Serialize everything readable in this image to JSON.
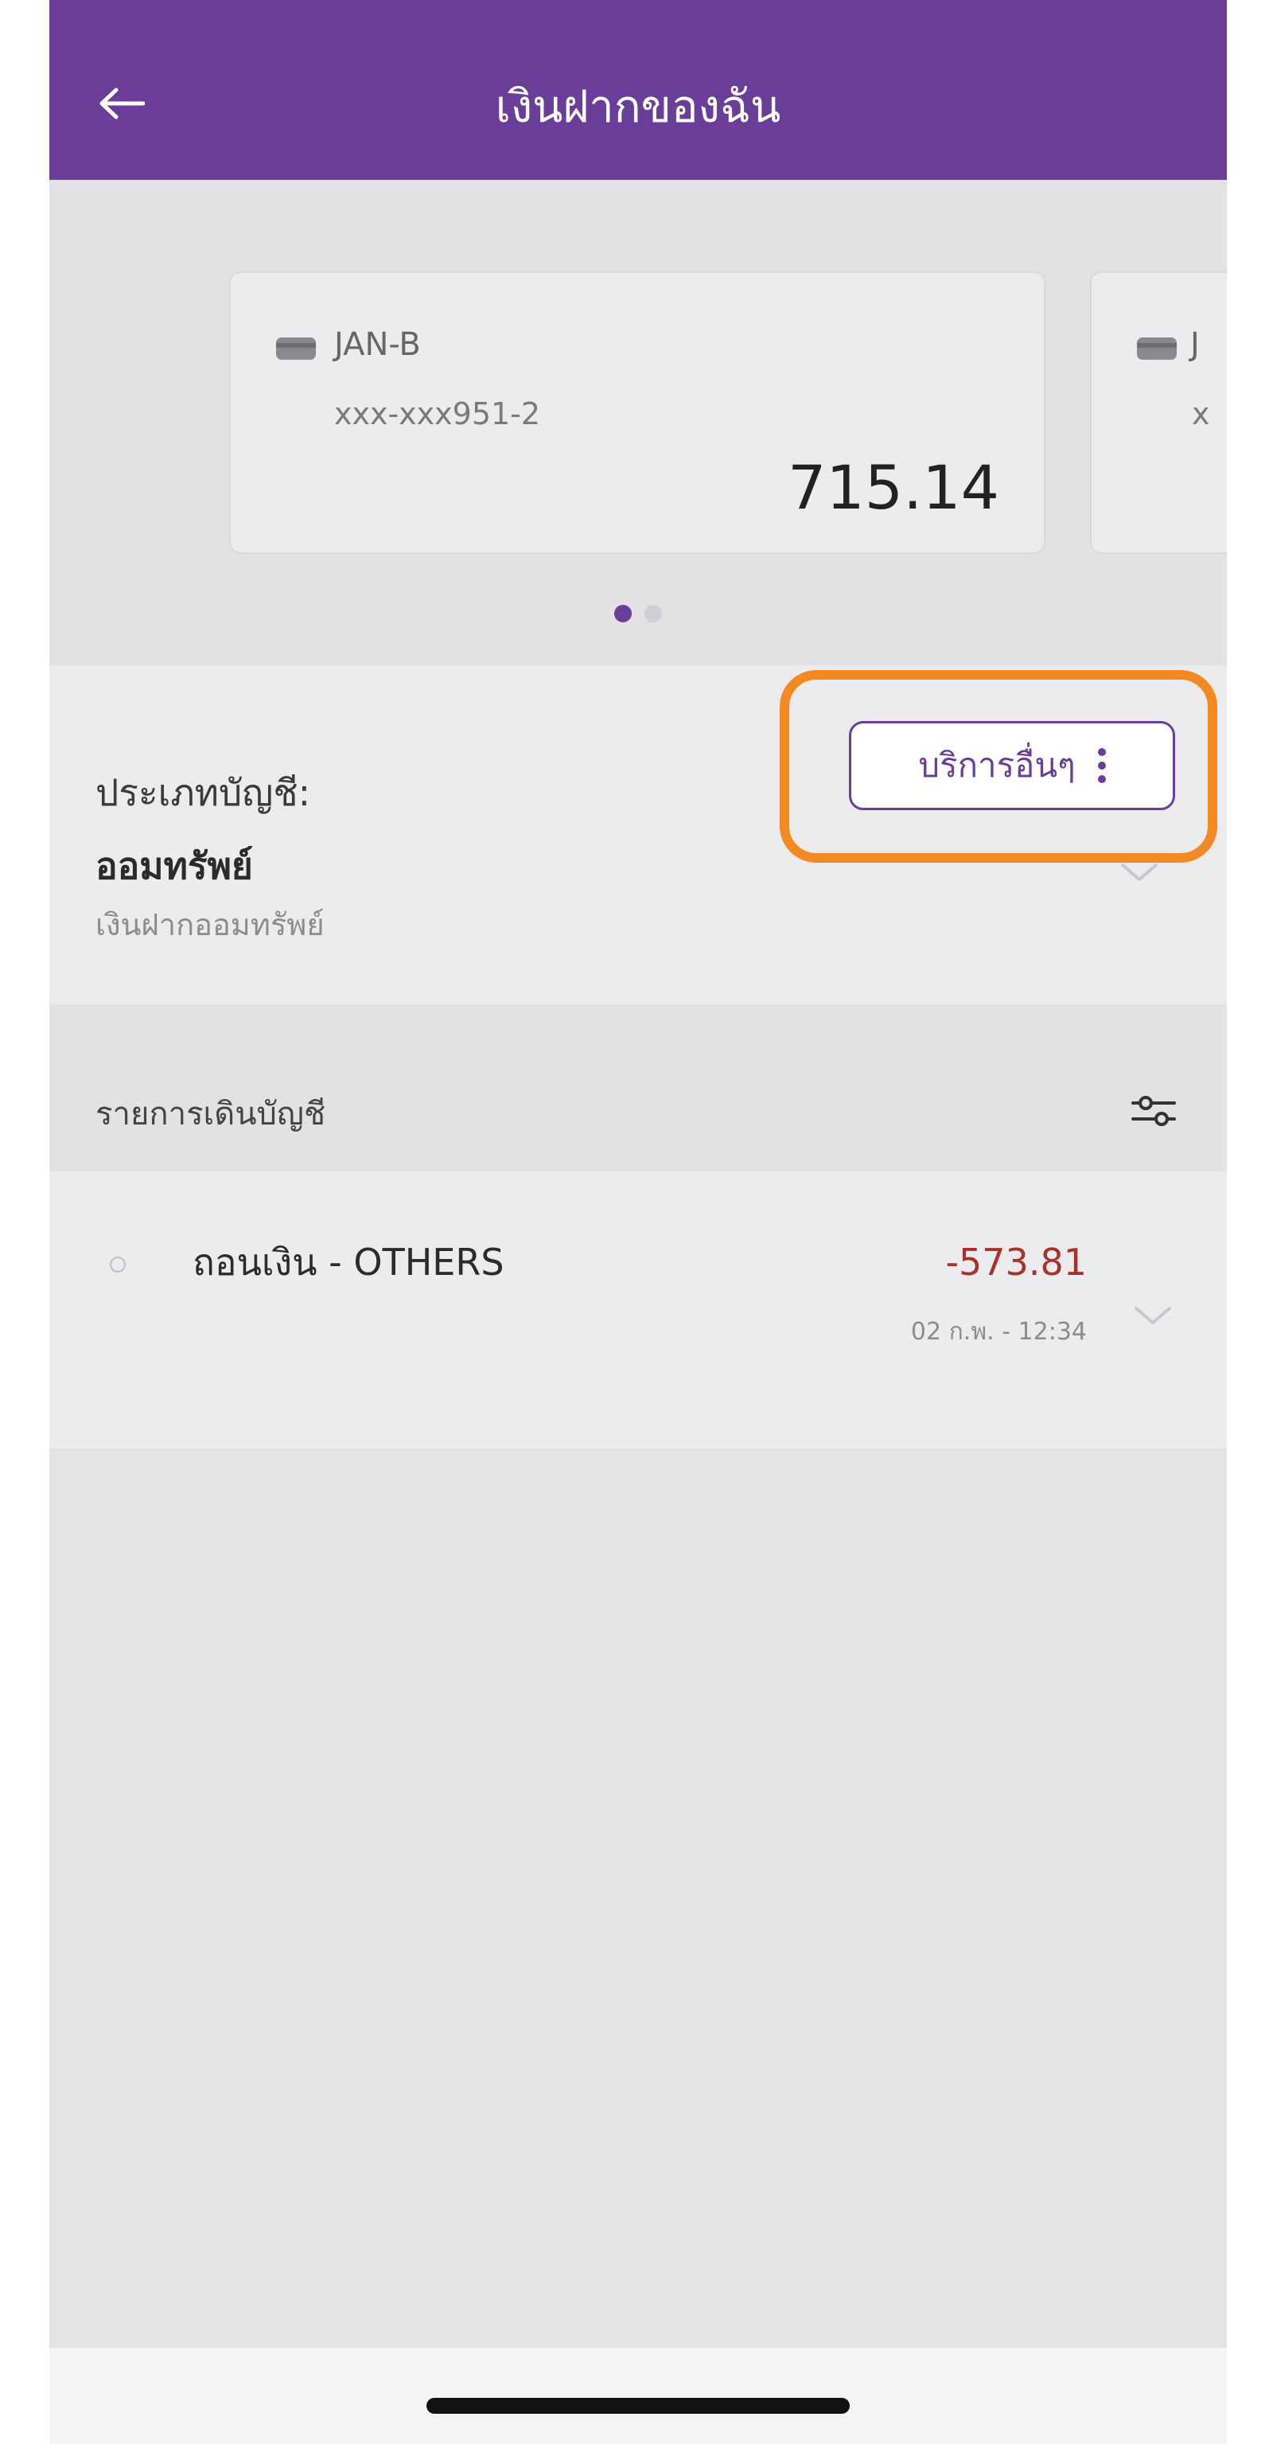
{
  "header": {
    "title": "เงินฝากของฉัน"
  },
  "accounts": [
    {
      "name": "JAN-B",
      "number": "xxx-xxx951-2",
      "balance": "715.14"
    },
    {
      "name": "J",
      "number": "x"
    }
  ],
  "carousel": {
    "page_count": 2,
    "active_index": 0
  },
  "account_panel": {
    "type_label": "ประเภทบัญชี:",
    "type_value": "ออมทรัพย์",
    "type_sub": "เงินฝากออมทรัพย์",
    "services_label": "บริการอื่นๆ"
  },
  "statement": {
    "title": "รายการเดินบัญชี",
    "transactions": [
      {
        "description": "ถอนเงิน - OTHERS",
        "amount": "-573.81",
        "time": "02 ก.พ. - 12:34"
      }
    ]
  },
  "colors": {
    "brand": "#6a3d98",
    "highlight": "#f38a21",
    "negative": "#a8322a"
  },
  "icons": {
    "back": "back-arrow-icon",
    "card": "card-icon",
    "menu": "kebab-menu-icon",
    "filter": "filter-sliders-icon",
    "expand": "chevron-down-icon"
  }
}
